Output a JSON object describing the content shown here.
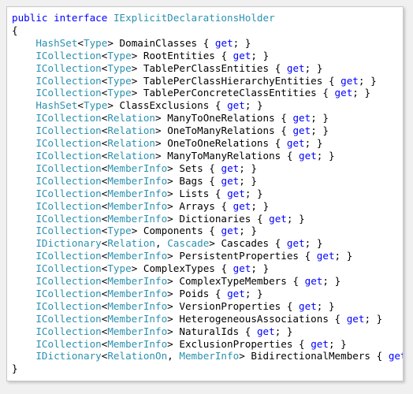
{
  "editor": {
    "language": "csharp",
    "background": "#ffffff",
    "page_background": "#f0f0f0",
    "border_color": "#c8c8c8"
  },
  "colors": {
    "keyword": "#0000ff",
    "type": "#2b91af",
    "punctuation": "#000000",
    "identifier": "#000000"
  },
  "declaration": {
    "modifier": "public",
    "kind": "interface",
    "name": "IExplicitDeclarationsHolder",
    "open_brace": "{",
    "close_brace": "}"
  },
  "accessor": {
    "open": "{",
    "get": "get",
    "semicolon": ";",
    "close": "}",
    "generic_open": "<",
    "generic_close": ">",
    "comma": ","
  },
  "members": [
    {
      "container": "HashSet",
      "generics": [
        "Type"
      ],
      "name": "DomainClasses"
    },
    {
      "container": "ICollection",
      "generics": [
        "Type"
      ],
      "name": "RootEntities"
    },
    {
      "container": "ICollection",
      "generics": [
        "Type"
      ],
      "name": "TablePerClassEntities"
    },
    {
      "container": "ICollection",
      "generics": [
        "Type"
      ],
      "name": "TablePerClassHierarchyEntities"
    },
    {
      "container": "ICollection",
      "generics": [
        "Type"
      ],
      "name": "TablePerConcreteClassEntities"
    },
    {
      "container": "HashSet",
      "generics": [
        "Type"
      ],
      "name": "ClassExclusions"
    },
    {
      "container": "ICollection",
      "generics": [
        "Relation"
      ],
      "name": "ManyToOneRelations"
    },
    {
      "container": "ICollection",
      "generics": [
        "Relation"
      ],
      "name": "OneToManyRelations"
    },
    {
      "container": "ICollection",
      "generics": [
        "Relation"
      ],
      "name": "OneToOneRelations"
    },
    {
      "container": "ICollection",
      "generics": [
        "Relation"
      ],
      "name": "ManyToManyRelations"
    },
    {
      "container": "ICollection",
      "generics": [
        "MemberInfo"
      ],
      "name": "Sets"
    },
    {
      "container": "ICollection",
      "generics": [
        "MemberInfo"
      ],
      "name": "Bags"
    },
    {
      "container": "ICollection",
      "generics": [
        "MemberInfo"
      ],
      "name": "Lists"
    },
    {
      "container": "ICollection",
      "generics": [
        "MemberInfo"
      ],
      "name": "Arrays"
    },
    {
      "container": "ICollection",
      "generics": [
        "MemberInfo"
      ],
      "name": "Dictionaries"
    },
    {
      "container": "ICollection",
      "generics": [
        "Type"
      ],
      "name": "Components"
    },
    {
      "container": "IDictionary",
      "generics": [
        "Relation",
        "Cascade"
      ],
      "name": "Cascades"
    },
    {
      "container": "ICollection",
      "generics": [
        "MemberInfo"
      ],
      "name": "PersistentProperties"
    },
    {
      "container": "ICollection",
      "generics": [
        "Type"
      ],
      "name": "ComplexTypes"
    },
    {
      "container": "ICollection",
      "generics": [
        "MemberInfo"
      ],
      "name": "ComplexTypeMembers"
    },
    {
      "container": "ICollection",
      "generics": [
        "MemberInfo"
      ],
      "name": "Poids"
    },
    {
      "container": "ICollection",
      "generics": [
        "MemberInfo"
      ],
      "name": "VersionProperties"
    },
    {
      "container": "ICollection",
      "generics": [
        "MemberInfo"
      ],
      "name": "HeterogeneousAssociations"
    },
    {
      "container": "ICollection",
      "generics": [
        "MemberInfo"
      ],
      "name": "NaturalIds"
    },
    {
      "container": "ICollection",
      "generics": [
        "MemberInfo"
      ],
      "name": "ExclusionProperties"
    },
    {
      "container": "IDictionary",
      "generics": [
        "RelationOn",
        "MemberInfo"
      ],
      "name": "BidirectionalMembers"
    }
  ]
}
